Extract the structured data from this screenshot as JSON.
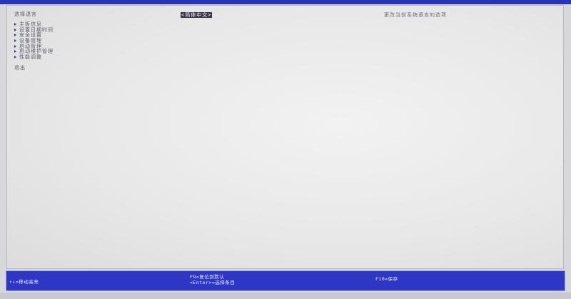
{
  "left_panel": {
    "section_title": "选择语言",
    "menu_items": [
      {
        "label": "主板信息"
      },
      {
        "label": "设置日期时间"
      },
      {
        "label": "安全设置"
      },
      {
        "label": "设备管理"
      },
      {
        "label": "启动管理"
      },
      {
        "label": "启动维护管理"
      },
      {
        "label": "性能调整"
      }
    ],
    "exit_label": "退出"
  },
  "language_value": "<简体中文>",
  "help_text": "更改当前系统语言的选项",
  "footer": {
    "hint_left": "↑↓=移动高亮",
    "hint_f9": "F9=复位到默认",
    "hint_enter": "<Enter>=选择条目",
    "hint_f10": "F10=保存"
  },
  "colors": {
    "accent": "#2e37c4",
    "panel": "#ececec",
    "text": "#5a5a6a"
  }
}
